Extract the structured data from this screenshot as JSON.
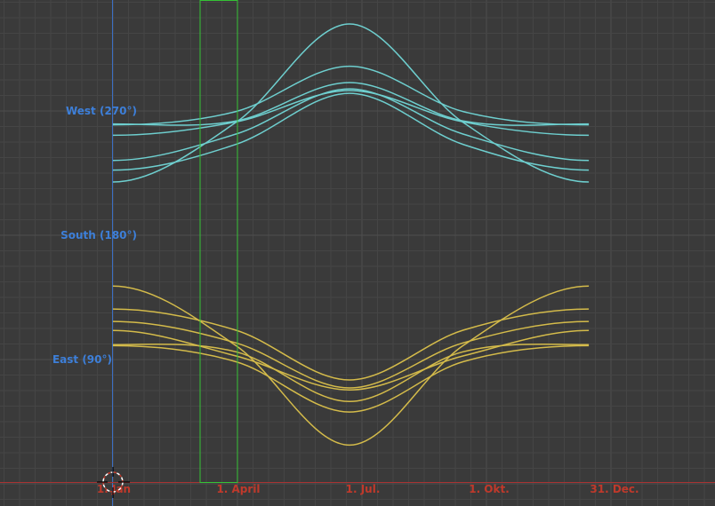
{
  "editor": "graph-editor",
  "y_labels": [
    {
      "id": "west",
      "text": "West (270°)"
    },
    {
      "id": "south",
      "text": "South (180°)"
    },
    {
      "id": "east",
      "text": "East (90°)"
    }
  ],
  "x_labels": [
    {
      "id": "jan",
      "text": "1. Jan"
    },
    {
      "id": "april",
      "text": "1. April"
    },
    {
      "id": "jul",
      "text": "1. Jul."
    },
    {
      "id": "okt",
      "text": "1. Okt."
    },
    {
      "id": "dec",
      "text": "31. Dec."
    }
  ],
  "colors": {
    "background": "#3a3a3a",
    "grid_minor": "#454545",
    "grid_major": "#4f4f4f",
    "west_curves": "#6ecfcf",
    "east_curves": "#d4bb4a",
    "vertical_axis": "#3b6fc4",
    "horizontal_axis": "#a83232",
    "selection_box": "#35c335",
    "y_label": "#3d7fd9",
    "x_label": "#c0392b"
  },
  "chart_data": {
    "type": "line",
    "x_unit": "day of year",
    "y_unit": "azimuth (degrees)",
    "xlim": [
      1,
      365
    ],
    "ylim": [
      30,
      330
    ],
    "selection_range": [
      64,
      91
    ],
    "series_west": [
      {
        "values": [
          {
            "x": 1,
            "y": 227.2
          },
          {
            "x": 90,
            "y": 245.8
          },
          {
            "x": 172,
            "y": 282.8
          },
          {
            "x": 254,
            "y": 245.8
          },
          {
            "x": 345,
            "y": 227.2
          }
        ]
      },
      {
        "values": [
          {
            "x": 1,
            "y": 234.2
          },
          {
            "x": 90,
            "y": 253.3
          },
          {
            "x": 172,
            "y": 286.0
          },
          {
            "x": 254,
            "y": 253.3
          },
          {
            "x": 345,
            "y": 234.2
          }
        ]
      },
      {
        "values": [
          {
            "x": 1,
            "y": 252.4
          },
          {
            "x": 90,
            "y": 262.1
          },
          {
            "x": 172,
            "y": 284.8
          },
          {
            "x": 254,
            "y": 262.1
          },
          {
            "x": 345,
            "y": 252.4
          }
        ]
      },
      {
        "values": [
          {
            "x": 1,
            "y": 260.6
          },
          {
            "x": 90,
            "y": 262.8
          },
          {
            "x": 172,
            "y": 290.6
          },
          {
            "x": 254,
            "y": 262.8
          },
          {
            "x": 345,
            "y": 260.6
          }
        ]
      },
      {
        "values": [
          {
            "x": 1,
            "y": 260.0
          },
          {
            "x": 90,
            "y": 269.6
          },
          {
            "x": 172,
            "y": 302.4
          },
          {
            "x": 254,
            "y": 269.6
          },
          {
            "x": 345,
            "y": 260.0
          }
        ]
      },
      {
        "values": [
          {
            "x": 1,
            "y": 218.6
          },
          {
            "x": 90,
            "y": 261.8
          },
          {
            "x": 172,
            "y": 333.0
          },
          {
            "x": 254,
            "y": 261.8
          },
          {
            "x": 345,
            "y": 218.6
          }
        ]
      }
    ],
    "series_east": [
      {
        "values": [
          {
            "x": 1,
            "y": 126.6
          },
          {
            "x": 90,
            "y": 111.2
          },
          {
            "x": 172,
            "y": 75.2
          },
          {
            "x": 254,
            "y": 111.2
          },
          {
            "x": 345,
            "y": 126.6
          }
        ]
      },
      {
        "values": [
          {
            "x": 1,
            "y": 117.6
          },
          {
            "x": 90,
            "y": 102.0
          },
          {
            "x": 172,
            "y": 69.4
          },
          {
            "x": 254,
            "y": 102.0
          },
          {
            "x": 345,
            "y": 117.6
          }
        ]
      },
      {
        "values": [
          {
            "x": 1,
            "y": 111.0
          },
          {
            "x": 90,
            "y": 92.6
          },
          {
            "x": 172,
            "y": 68.0
          },
          {
            "x": 254,
            "y": 92.6
          },
          {
            "x": 345,
            "y": 111.0
          }
        ]
      },
      {
        "values": [
          {
            "x": 1,
            "y": 100.8
          },
          {
            "x": 90,
            "y": 95.6
          },
          {
            "x": 172,
            "y": 59.6
          },
          {
            "x": 254,
            "y": 95.6
          },
          {
            "x": 345,
            "y": 100.8
          }
        ]
      },
      {
        "values": [
          {
            "x": 1,
            "y": 100.0
          },
          {
            "x": 90,
            "y": 88.4
          },
          {
            "x": 172,
            "y": 52.0
          },
          {
            "x": 254,
            "y": 88.4
          },
          {
            "x": 345,
            "y": 100.0
          }
        ]
      },
      {
        "values": [
          {
            "x": 1,
            "y": 143.2
          },
          {
            "x": 90,
            "y": 100.0
          },
          {
            "x": 172,
            "y": 28.0
          },
          {
            "x": 254,
            "y": 100.0
          },
          {
            "x": 345,
            "y": 143.2
          }
        ]
      }
    ]
  }
}
